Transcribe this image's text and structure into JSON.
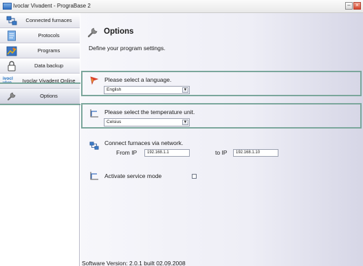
{
  "window": {
    "title": "Ivoclar Vivadent - PrograBase 2",
    "min_symbol": "–",
    "close_symbol": "×"
  },
  "sidebar": {
    "items": [
      {
        "label": "Connected furnaces",
        "icon": "network-icon"
      },
      {
        "label": "Protocols",
        "icon": "document-icon"
      },
      {
        "label": "Programs",
        "icon": "program-icon"
      },
      {
        "label": "Data backup",
        "icon": "lock-icon"
      },
      {
        "label": "Ivoclar Vivadent Online",
        "icon": "ivoclar-logo-icon"
      },
      {
        "label": "Options",
        "icon": "wrench-icon"
      }
    ],
    "logo_text": "ivocl vivo"
  },
  "main": {
    "title": "Options",
    "description": "Define your program settings.",
    "language": {
      "label": "Please select a language.",
      "value": "English"
    },
    "temperature": {
      "label": "Please select the temperature unit.",
      "value": "Celsius"
    },
    "network": {
      "label": "Connect furnaces via network.",
      "from_label": "From IP",
      "from_value": "192.168.1.1",
      "to_label": "to IP",
      "to_value": "192.168.1.10"
    },
    "service": {
      "label": "Activate service mode",
      "checked": false
    },
    "version": "Software Version: 2.0.1 built 02.09.2008"
  },
  "colors": {
    "accent_border": "#7aa69b",
    "title_text": "#1a1a1a"
  }
}
